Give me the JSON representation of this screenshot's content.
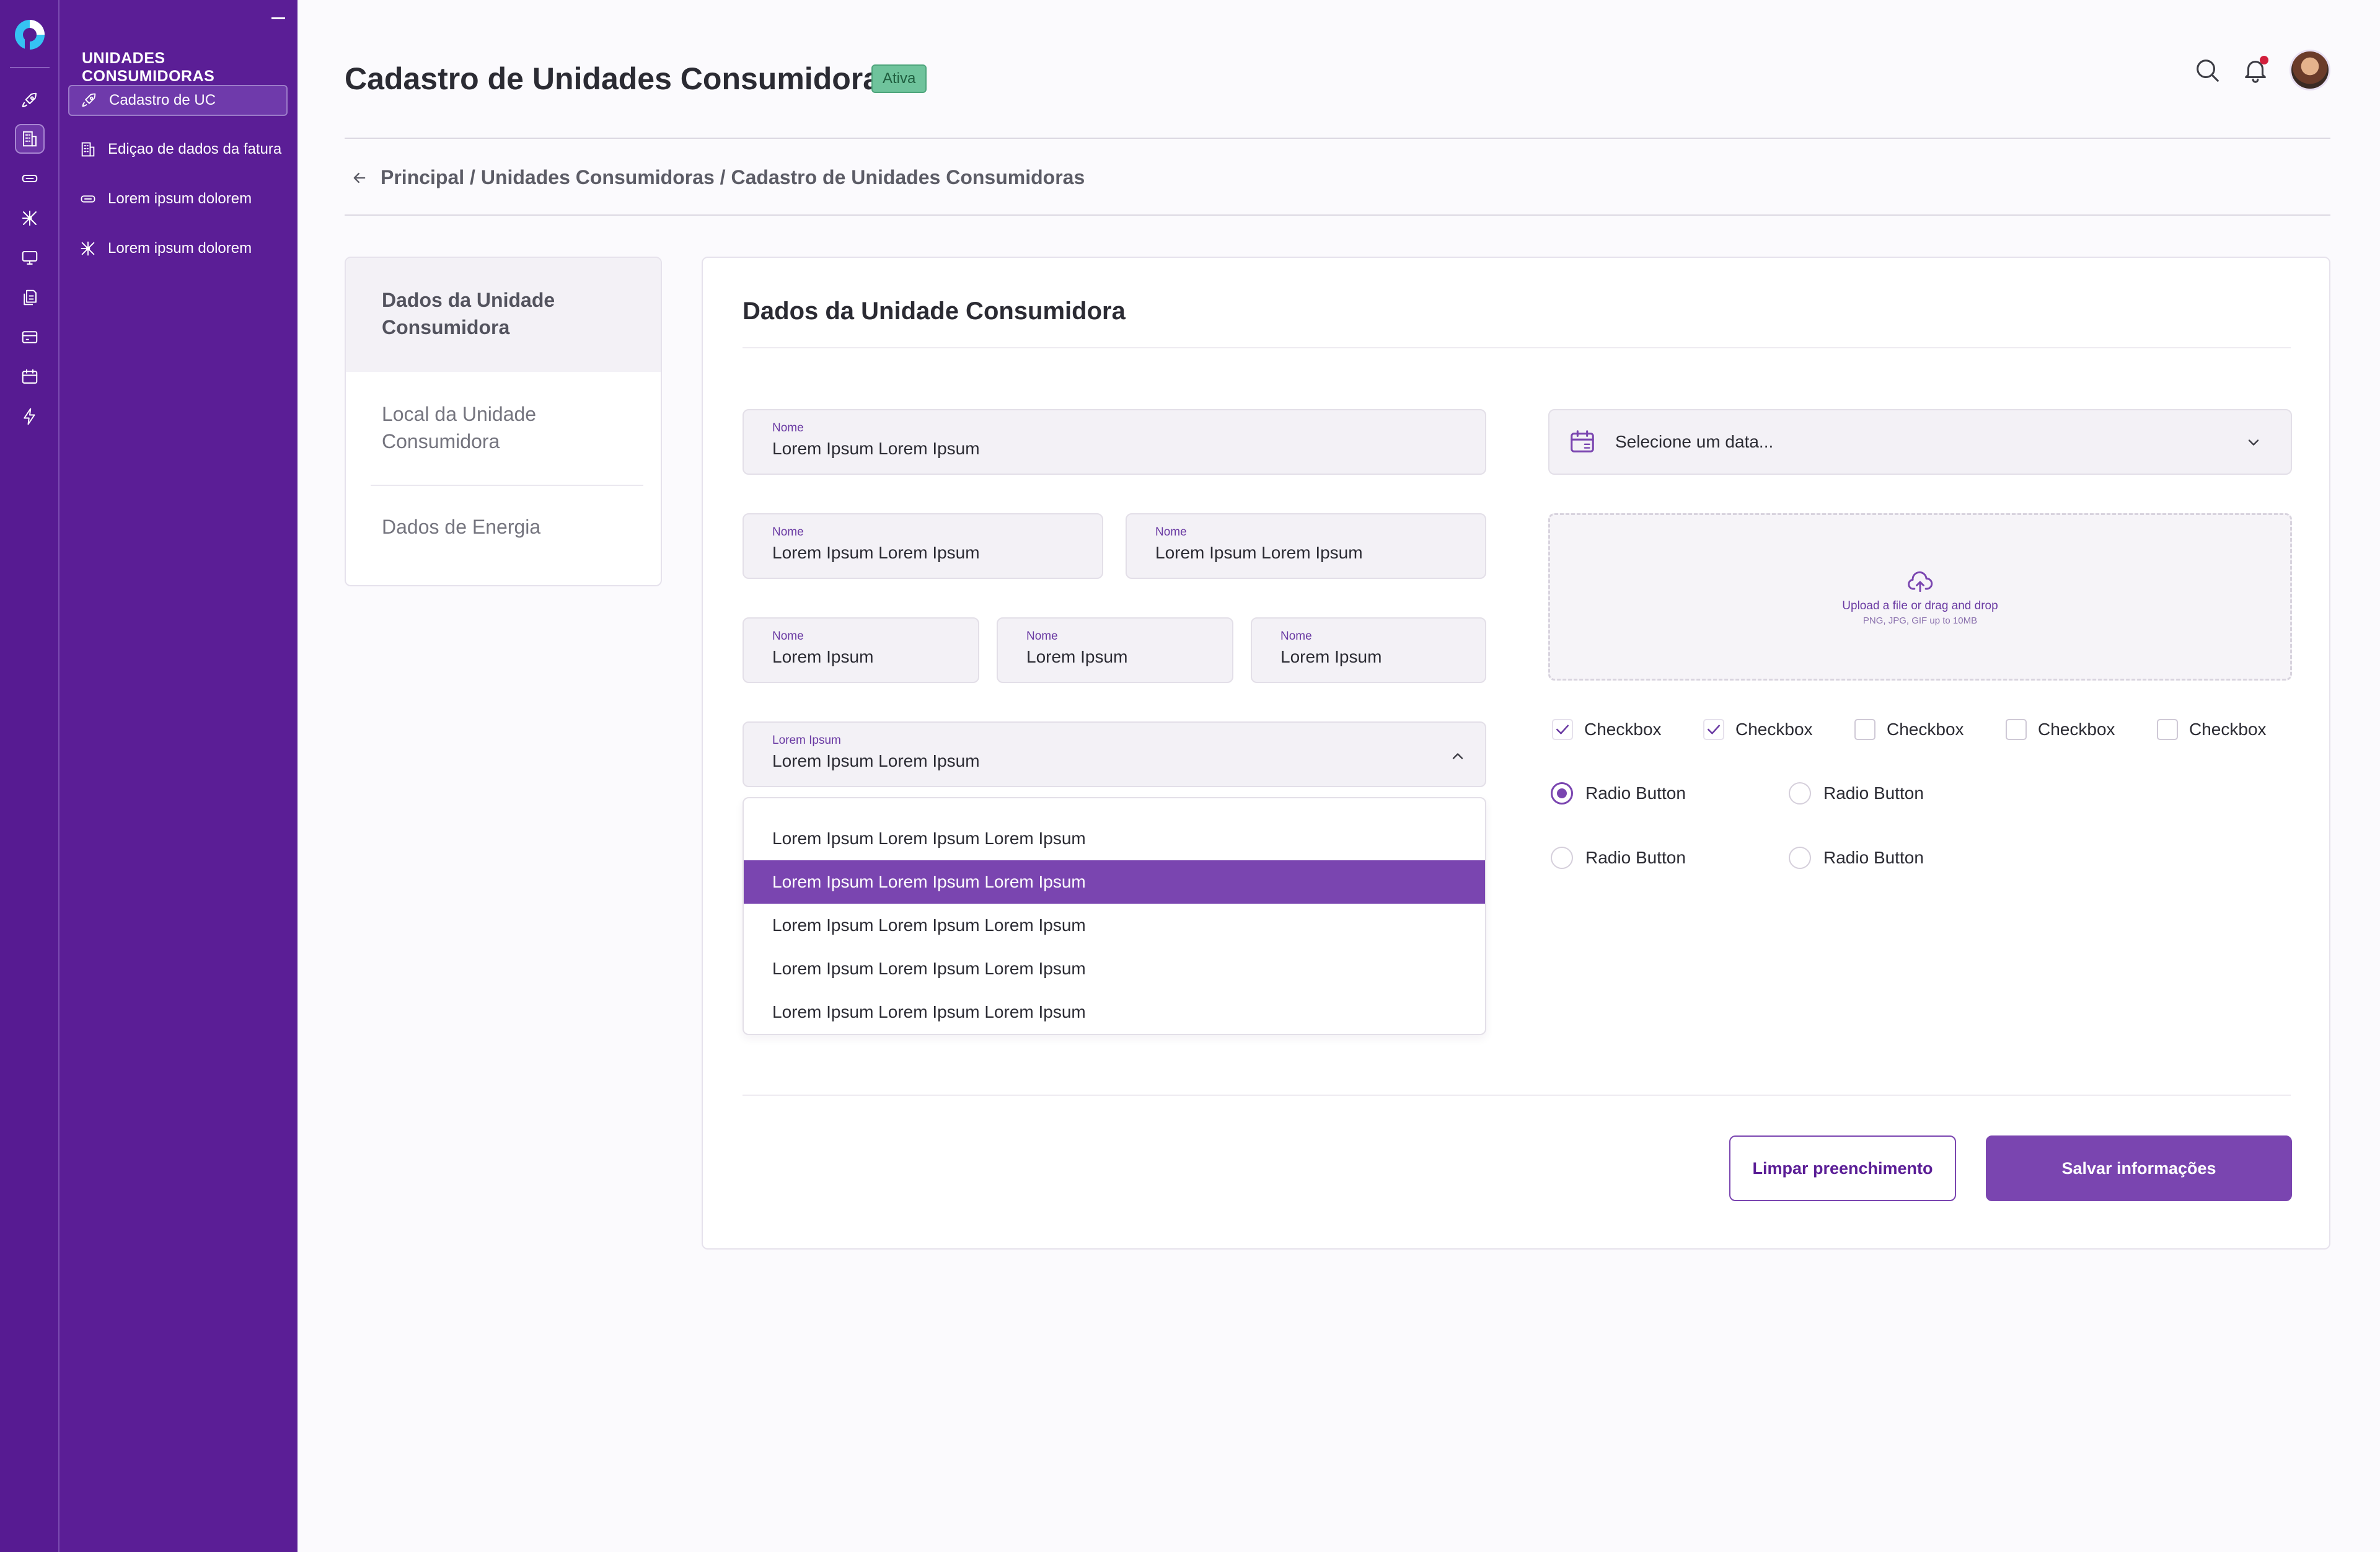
{
  "colors": {
    "primary": "#7a45b0",
    "sidebar": "#5b1e96",
    "rail": "#571b92",
    "badge": "#6fc39c",
    "notification": "#d21f3c"
  },
  "rail": {
    "icons": [
      "logo-icon",
      "rocket-icon",
      "building-icon",
      "card-icon",
      "network-icon",
      "monitor-icon",
      "documents-icon",
      "payment-card-icon",
      "calendar-icon",
      "lightning-icon"
    ]
  },
  "subnav": {
    "heading": "UNIDADES CONSUMIDORAS",
    "items": [
      {
        "label": "Cadastro de UC",
        "icon": "rocket-icon"
      },
      {
        "label": "Ediçao de dados da fatura",
        "icon": "building-icon"
      },
      {
        "label": "Lorem ipsum dolorem",
        "icon": "card-icon"
      },
      {
        "label": "Lorem ipsum dolorem",
        "icon": "network-icon"
      }
    ]
  },
  "header": {
    "title": "Cadastro de Unidades Consumidoras",
    "status": "Ativa",
    "breadcrumb": "Principal / Unidades Consumidoras / Cadastro de Unidades Consumidoras"
  },
  "steps": [
    "Dados da Unidade Consumidora",
    "Local da Unidade Consumidora",
    "Dados de Energia"
  ],
  "form": {
    "title": "Dados da Unidade Consumidora",
    "fields": [
      {
        "label": "Nome",
        "value": "Lorem Ipsum Lorem Ipsum"
      },
      {
        "label": "Nome",
        "value": "Lorem Ipsum Lorem Ipsum"
      },
      {
        "label": "Nome",
        "value": "Lorem Ipsum Lorem Ipsum"
      },
      {
        "label": "Nome",
        "value": "Lorem Ipsum"
      },
      {
        "label": "Nome",
        "value": "Lorem Ipsum"
      },
      {
        "label": "Nome",
        "value": "Lorem Ipsum"
      }
    ],
    "select": {
      "label": "Lorem Ipsum",
      "value": "Lorem Ipsum Lorem Ipsum",
      "options": [
        "Lorem Ipsum Lorem Ipsum Lorem Ipsum",
        "Lorem Ipsum Lorem Ipsum Lorem Ipsum",
        "Lorem Ipsum Lorem Ipsum Lorem Ipsum",
        "Lorem Ipsum Lorem Ipsum Lorem Ipsum",
        "Lorem Ipsum Lorem Ipsum Lorem Ipsum"
      ],
      "selected_index": 1
    },
    "date_placeholder": "Selecione um data...",
    "upload": {
      "line1": "Upload a file or drag and drop",
      "line2": "PNG, JPG, GIF up to 10MB"
    },
    "checkboxes": [
      {
        "label": "Checkbox",
        "checked": true
      },
      {
        "label": "Checkbox",
        "checked": true
      },
      {
        "label": "Checkbox",
        "checked": false
      },
      {
        "label": "Checkbox",
        "checked": false
      },
      {
        "label": "Checkbox",
        "checked": false
      }
    ],
    "radios": [
      {
        "label": "Radio Button",
        "selected": true
      },
      {
        "label": "Radio Button",
        "selected": false
      },
      {
        "label": "Radio Button",
        "selected": false
      },
      {
        "label": "Radio Button",
        "selected": false
      }
    ],
    "clear_label": "Limpar preenchimento",
    "save_label": "Salvar informações"
  }
}
